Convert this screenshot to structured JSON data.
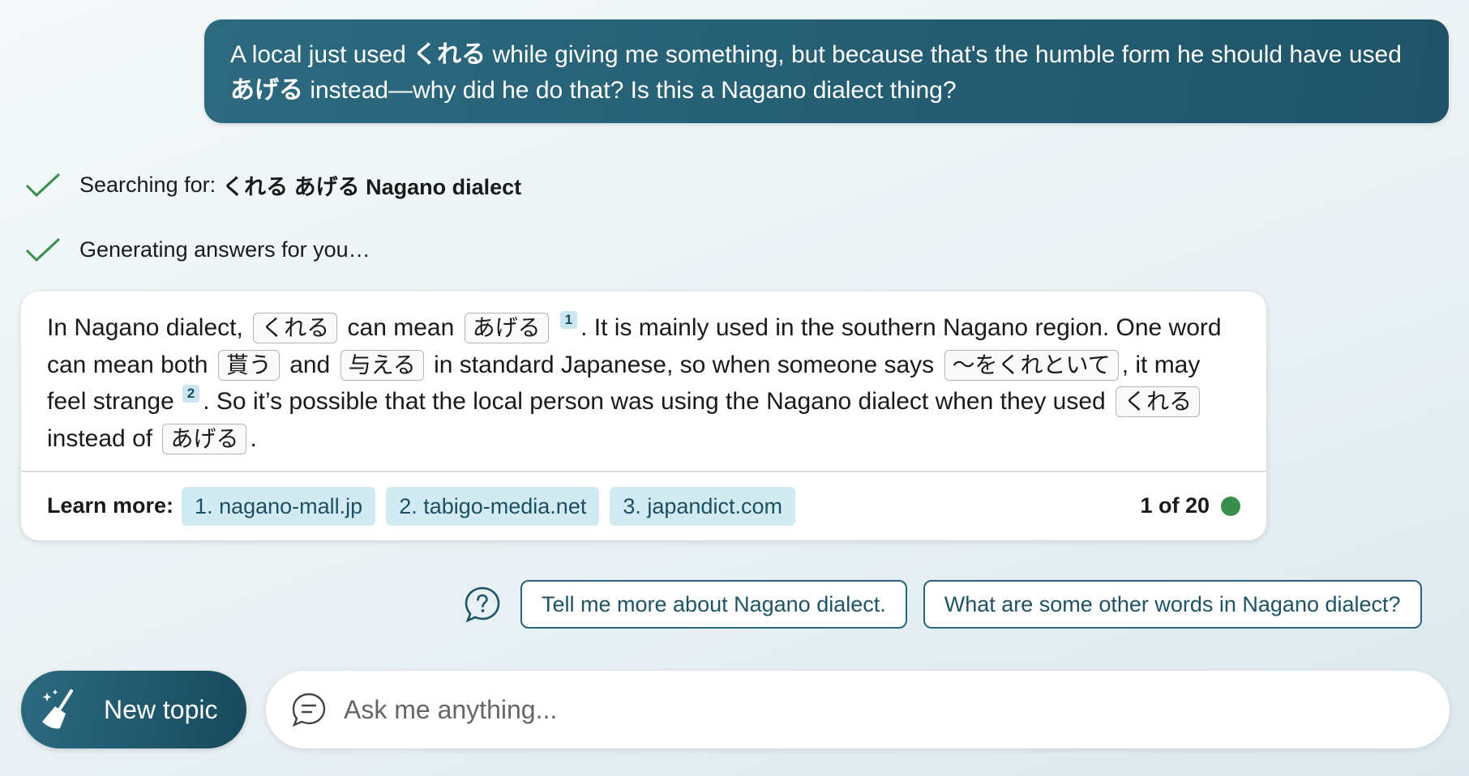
{
  "user_message": {
    "part1": "A local just used ",
    "jp1": "くれる",
    "part2": " while giving me something, but because that's the humble form he should have used ",
    "jp2": "あげる",
    "part3": " instead—why did he do that? Is this a Nagano dialect thing?"
  },
  "progress": {
    "search_prefix": "Searching for:",
    "search_query": "くれる あげる Nagano dialect",
    "generating": "Generating answers for you…"
  },
  "answer": {
    "t1": "In Nagano dialect,",
    "c1": "くれる",
    "t2": "can mean",
    "c2": "あげる",
    "ref1": "1",
    "t3": ". It is mainly used in the southern Nagano region. One word can mean both",
    "c3": "貰う",
    "t4": "and",
    "c4": "与える",
    "t5": "in standard Japanese, so when someone says",
    "c5": "〜をくれといて",
    "t6": ", it may feel strange",
    "ref2": "2",
    "t7": ". So it’s possible that the local person was using the Nagano dialect when they used",
    "c6": "くれる",
    "t8": "instead of",
    "c7": "あげる",
    "t9": "."
  },
  "learn_more": {
    "label": "Learn more:",
    "sources": [
      "1. nagano-mall.jp",
      "2. tabigo-media.net",
      "3. japandict.com"
    ],
    "page_count": "1 of 20"
  },
  "suggestions": [
    "Tell me more about Nagano dialect.",
    "What are some other words in Nagano dialect?"
  ],
  "new_topic": {
    "label": "New topic"
  },
  "ask": {
    "placeholder": "Ask me anything..."
  },
  "colors": {
    "accent": "#1f5468",
    "check_green": "#3a8f4e",
    "source_chip_bg": "#d2ebf3"
  }
}
